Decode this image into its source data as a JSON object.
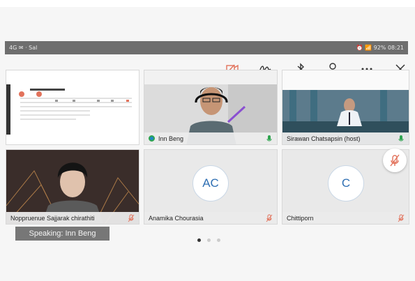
{
  "status_bar": {
    "left": "4G ✉ · Sal",
    "right": "⏰ 📶 92% 08:21"
  },
  "toolbar": {
    "icons": [
      "camera-off-icon",
      "annotate-icon",
      "bluetooth-icon",
      "participants-icon",
      "more-icon",
      "close-icon"
    ]
  },
  "participants": [
    {
      "name": "",
      "kind": "screen-share"
    },
    {
      "name": "Inn Beng",
      "kind": "video",
      "mic": "on"
    },
    {
      "name": "Sirawan Chatsapsin (host)",
      "kind": "video",
      "mic": "on"
    },
    {
      "name": "Noppruenue Sajjarak chirathiti",
      "kind": "video",
      "mic": "muted"
    },
    {
      "name": "Anamika Chourasia",
      "initials": "AC",
      "kind": "avatar",
      "mic": "muted"
    },
    {
      "name": "Chittiporn",
      "initials": "C",
      "kind": "avatar",
      "mic": "muted"
    }
  ],
  "speaking": "Speaking: Inn Beng",
  "pager": {
    "current": 1,
    "total": 3
  },
  "colors": {
    "muted": "#e2725b",
    "mic_on": "#2ea44f",
    "accent": "#2f6fb3"
  }
}
